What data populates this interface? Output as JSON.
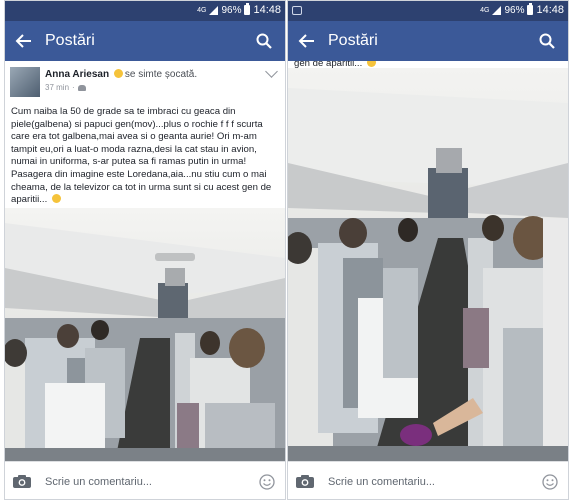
{
  "status_bar": {
    "network": "4G",
    "battery": "96%",
    "time": "14:48"
  },
  "app_bar": {
    "title": "Postări"
  },
  "post": {
    "author": "Anna Ariesan",
    "feeling": "se simte șocată.",
    "time": "37 min",
    "separator": "·",
    "text": "Cum naiba la 50 de grade sa te imbraci cu geaca din piele(galbena) si papuci gen(mov)...plus o rochie f  f f scurta care era tot galbena,mai avea si o geanta aurie! Ori m-am tampit eu,ori a luat-o moda razna,desi la cat stau in avion, numai in uniforma, s-ar putea sa fi ramas putin in urma! Pasagera din imagine este Loredana,aia...nu stiu cum o mai cheama, de la televizor ca tot in urma sunt si cu acest gen de aparitii..."
  },
  "right_caption": "gen de aparitii...",
  "comment_bar": {
    "placeholder": "Scrie un comentariu..."
  },
  "icons": [
    "back-arrow-icon",
    "search-icon",
    "camera-icon",
    "smiley-icon",
    "friends-icon",
    "chevron-down-icon",
    "battery-icon",
    "signal-icon"
  ],
  "colors": {
    "status_bar": "#2d4170",
    "app_bar": "#3b5998",
    "feed": "#ffffff"
  }
}
